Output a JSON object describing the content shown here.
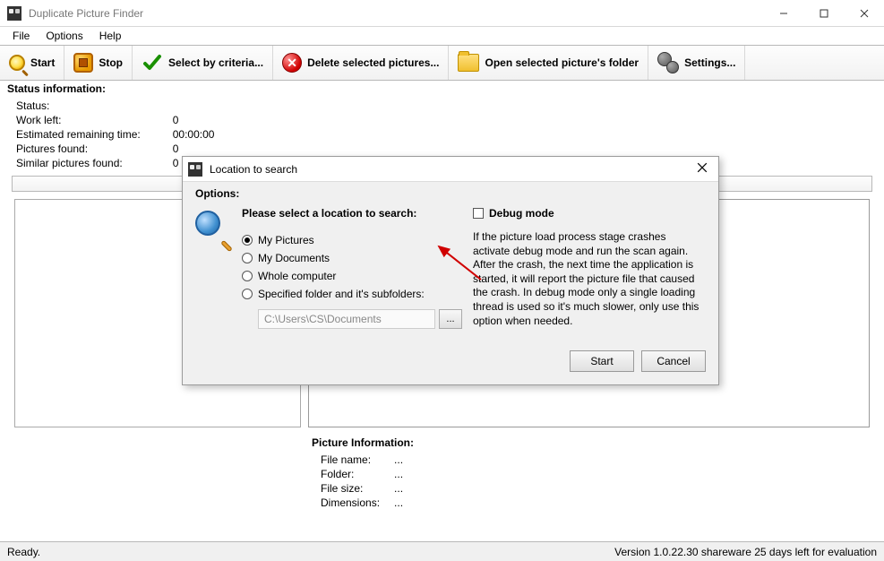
{
  "window": {
    "title": "Duplicate Picture Finder"
  },
  "menu": {
    "file": "File",
    "options": "Options",
    "help": "Help"
  },
  "toolbar": {
    "start": "Start",
    "stop": "Stop",
    "select": "Select by criteria...",
    "delete": "Delete selected pictures...",
    "open_folder": "Open selected picture's folder",
    "settings": "Settings..."
  },
  "status_section": {
    "heading": "Status information:",
    "rows": {
      "status_label": "Status:",
      "status_val": "",
      "workleft_label": "Work left:",
      "workleft_val": "0",
      "remaining_label": "Estimated remaining time:",
      "remaining_val": "00:00:00",
      "pictures_label": "Pictures found:",
      "pictures_val": "0",
      "similar_label": "Similar pictures found:",
      "similar_val": "0"
    }
  },
  "picture_info": {
    "heading": "Picture Information:",
    "filename_label": "File name:",
    "filename_val": "...",
    "folder_label": "Folder:",
    "folder_val": "...",
    "filesize_label": "File size:",
    "filesize_val": "...",
    "dimensions_label": "Dimensions:",
    "dimensions_val": "..."
  },
  "statusbar": {
    "left": "Ready.",
    "right": "Version 1.0.22.30 shareware 25 days left for evaluation"
  },
  "dialog": {
    "title": "Location to search",
    "options_label": "Options:",
    "select_heading": "Please select a location to search:",
    "radios": {
      "my_pictures": "My Pictures",
      "my_documents": "My Documents",
      "whole_computer": "Whole computer",
      "specified": "Specified folder and it's subfolders:"
    },
    "path_value": "C:\\Users\\CS\\Documents",
    "browse_label": "...",
    "debug_label": "Debug mode",
    "debug_text": "If the picture load process stage crashes activate debug mode and run the scan again. After the crash, the next time the application is started, it will report the picture file that caused the crash. In debug mode only a single loading thread is used so it's much slower, only use this option when needed.",
    "start_btn": "Start",
    "cancel_btn": "Cancel"
  }
}
